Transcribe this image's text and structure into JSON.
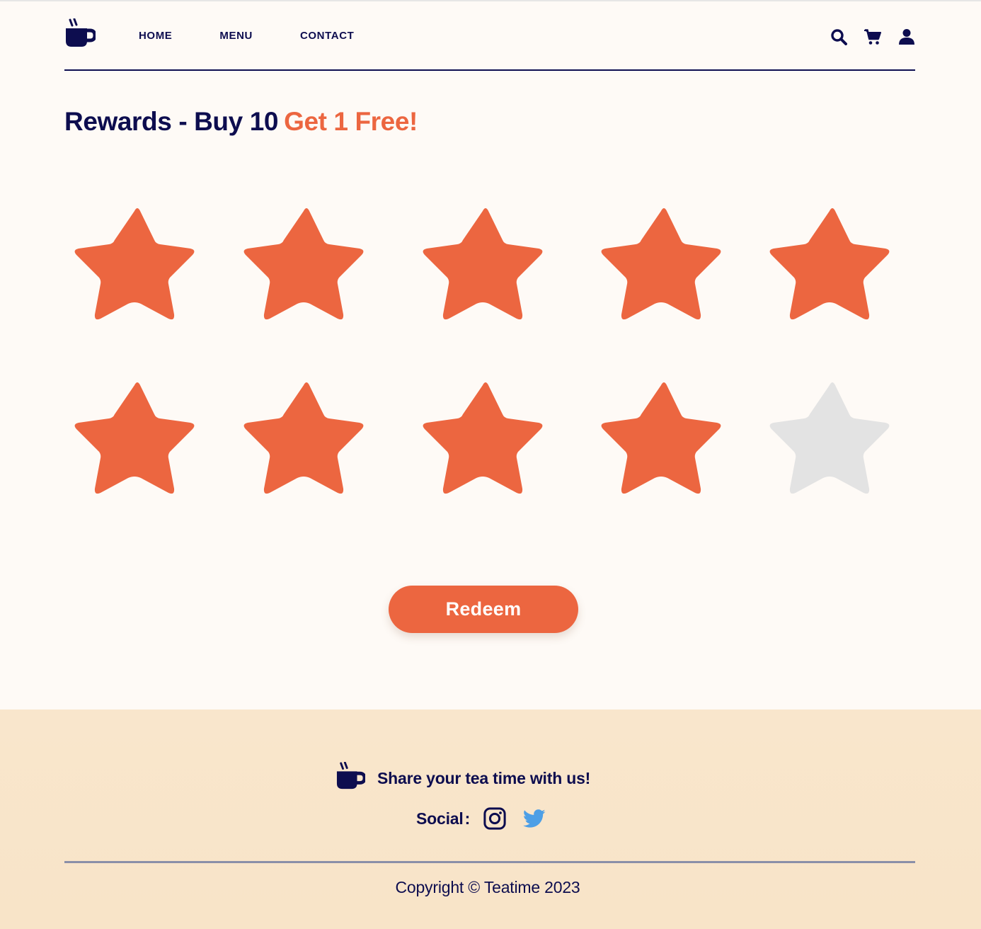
{
  "nav": {
    "items": [
      {
        "label": "HOME"
      },
      {
        "label": "MENU"
      },
      {
        "label": "CONTACT"
      }
    ],
    "icons": [
      "search-icon",
      "cart-icon",
      "user-icon"
    ]
  },
  "rewards": {
    "title_main": "Rewards - Buy 10",
    "title_accent": "Get 1 Free!",
    "stamps_total": 10,
    "stamps_earned": 9
  },
  "actions": {
    "redeem_label": "Redeem"
  },
  "footer": {
    "share_text": "Share your tea time with us!",
    "social_label": "Social",
    "social_colon": ":",
    "social_icons": [
      "instagram-icon",
      "twitter-icon"
    ],
    "copyright": "Copyright © Teatime 2023"
  },
  "colors": {
    "navy": "#0d0d4f",
    "accent": "#ec6640",
    "star_empty": "#e3e3e3",
    "background": "#fefaf6",
    "footer_bg": "#f9e6cc",
    "twitter": "#4d9fe6"
  }
}
